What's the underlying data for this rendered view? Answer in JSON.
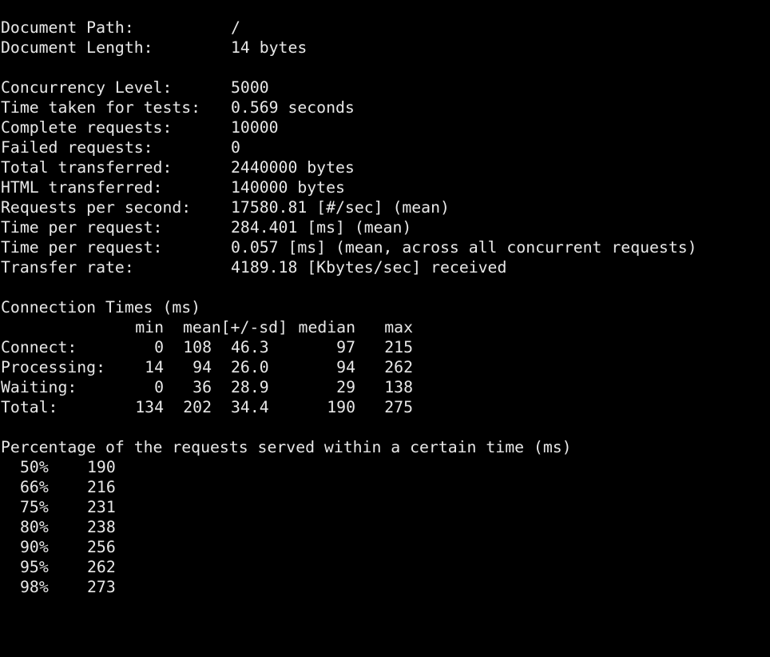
{
  "colors": {
    "background": "#000000",
    "text": "#e8e8e8"
  },
  "summary_top": [
    {
      "label": "Document Path:",
      "value": "/"
    },
    {
      "label": "Document Length:",
      "value": "14 bytes"
    }
  ],
  "summary_main": [
    {
      "label": "Concurrency Level:",
      "value": "5000"
    },
    {
      "label": "Time taken for tests:",
      "value": "0.569 seconds"
    },
    {
      "label": "Complete requests:",
      "value": "10000"
    },
    {
      "label": "Failed requests:",
      "value": "0"
    },
    {
      "label": "Total transferred:",
      "value": "2440000 bytes"
    },
    {
      "label": "HTML transferred:",
      "value": "140000 bytes"
    },
    {
      "label": "Requests per second:",
      "value": "17580.81 [#/sec] (mean)"
    },
    {
      "label": "Time per request:",
      "value": "284.401 [ms] (mean)"
    },
    {
      "label": "Time per request:",
      "value": "0.057 [ms] (mean, across all concurrent requests)"
    },
    {
      "label": "Transfer rate:",
      "value": "4189.18 [Kbytes/sec] received"
    }
  ],
  "connection_times": {
    "title": "Connection Times (ms)",
    "headers": {
      "min": "min",
      "mean_sd": "mean[+/-sd]",
      "median": "median",
      "max": "max"
    },
    "rows": [
      {
        "label": "Connect:",
        "min": "0",
        "mean": "108",
        "sd": "46.3",
        "median": "97",
        "max": "215"
      },
      {
        "label": "Processing:",
        "min": "14",
        "mean": "94",
        "sd": "26.0",
        "median": "94",
        "max": "262"
      },
      {
        "label": "Waiting:",
        "min": "0",
        "mean": "36",
        "sd": "28.9",
        "median": "29",
        "max": "138"
      },
      {
        "label": "Total:",
        "min": "134",
        "mean": "202",
        "sd": "34.4",
        "median": "190",
        "max": "275"
      }
    ]
  },
  "percentiles": {
    "title": "Percentage of the requests served within a certain time (ms)",
    "rows": [
      {
        "pct": "50%",
        "ms": "190"
      },
      {
        "pct": "66%",
        "ms": "216"
      },
      {
        "pct": "75%",
        "ms": "231"
      },
      {
        "pct": "80%",
        "ms": "238"
      },
      {
        "pct": "90%",
        "ms": "256"
      },
      {
        "pct": "95%",
        "ms": "262"
      },
      {
        "pct": "98%",
        "ms": "273"
      }
    ]
  }
}
